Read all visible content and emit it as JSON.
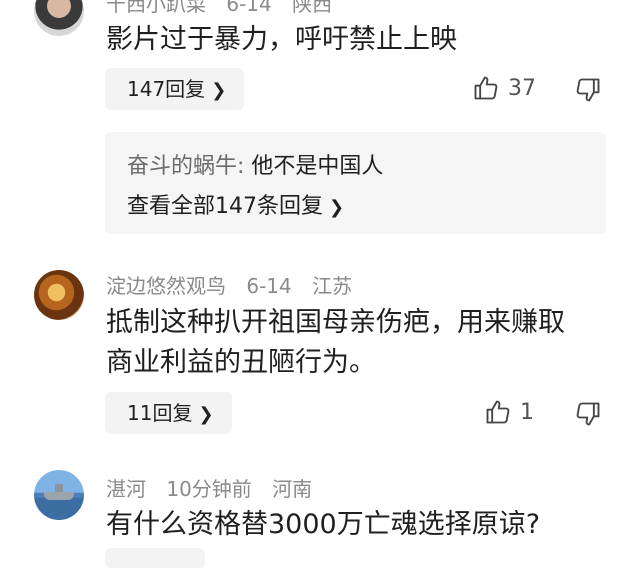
{
  "comments": [
    {
      "user": "千西小趴菜",
      "date": "6-14",
      "location": "陕西",
      "text": "影片过于暴力，呼吁禁止上映",
      "reply_button": "147回复",
      "likes": "37"
    },
    {
      "user": "淀边悠然观鸟",
      "date": "6-14",
      "location": "江苏",
      "text_line1": "抵制这种扒开祖国母亲伤疤，用来赚取",
      "text_line2": "商业利益的丑陋行为。",
      "reply_button": "11回复",
      "likes": "1"
    },
    {
      "user": "湛河",
      "date": "10分钟前",
      "location": "河南",
      "text": "有什么资格替3000万亡魂选择原谅?"
    }
  ],
  "reply_preview": {
    "author": "奋斗的蜗牛:",
    "text": " 他不是中国人",
    "view_all": "查看全部147条回复"
  },
  "icons": {
    "like": "thumbs-up-icon",
    "dislike": "thumbs-down-icon",
    "chevron": "chevron-right-icon"
  }
}
